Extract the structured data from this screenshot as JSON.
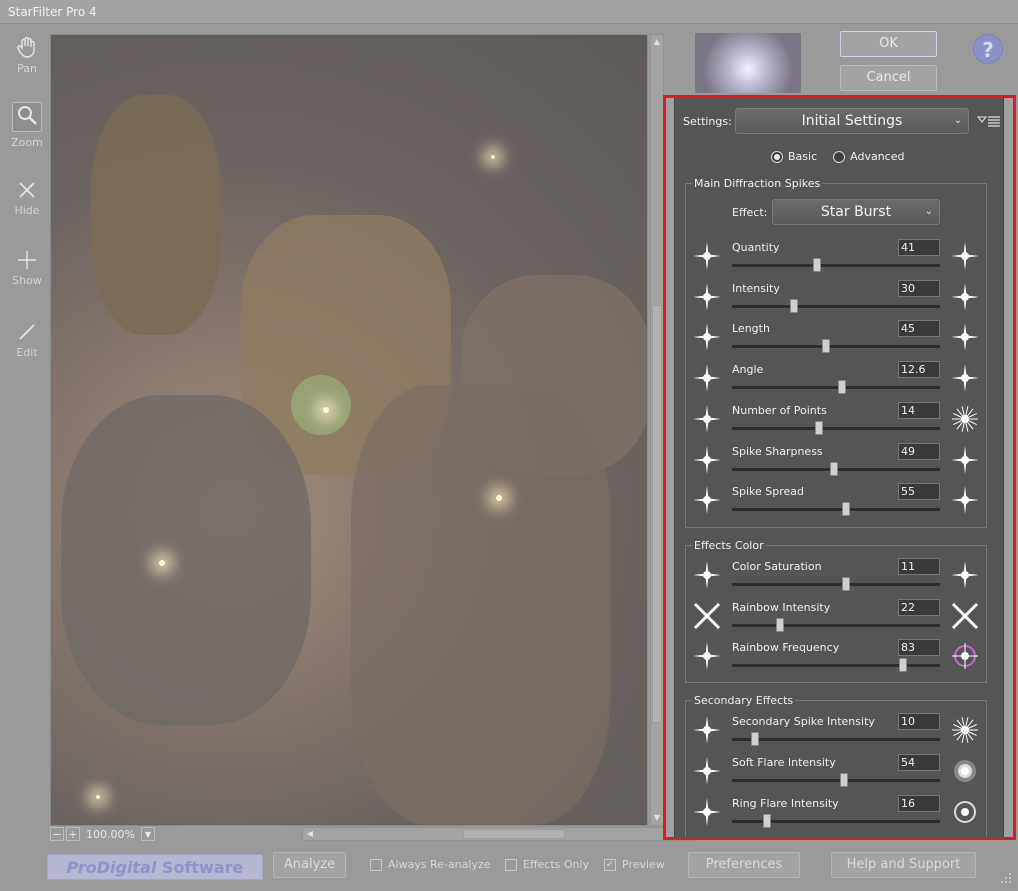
{
  "window": {
    "title": "StarFilter Pro 4"
  },
  "toolbar": {
    "pan": "Pan",
    "zoom": "Zoom",
    "hide": "Hide",
    "show": "Show",
    "edit": "Edit"
  },
  "zoom": {
    "level": "100.00%"
  },
  "buttons": {
    "ok": "OK",
    "cancel": "Cancel",
    "help": "?"
  },
  "settings": {
    "label": "Settings:",
    "selected": "Initial Settings"
  },
  "mode": {
    "basic": "Basic",
    "advanced": "Advanced",
    "selected": "Basic"
  },
  "main_spikes": {
    "title": "Main Diffraction Spikes",
    "effect_label": "Effect:",
    "effect_value": "Star Burst",
    "params": [
      {
        "label": "Quantity",
        "value": "41",
        "pos": 41
      },
      {
        "label": "Intensity",
        "value": "30",
        "pos": 30
      },
      {
        "label": "Length",
        "value": "45",
        "pos": 45
      },
      {
        "label": "Angle",
        "value": "12.6",
        "pos": 53
      },
      {
        "label": "Number of Points",
        "value": "14",
        "pos": 42
      },
      {
        "label": "Spike Sharpness",
        "value": "49",
        "pos": 49
      },
      {
        "label": "Spike Spread",
        "value": "55",
        "pos": 55
      }
    ]
  },
  "effects_color": {
    "title": "Effects Color",
    "params": [
      {
        "label": "Color Saturation",
        "value": "11",
        "pos": 55
      },
      {
        "label": "Rainbow Intensity",
        "value": "22",
        "pos": 23
      },
      {
        "label": "Rainbow Frequency",
        "value": "83",
        "pos": 82
      }
    ]
  },
  "secondary": {
    "title": "Secondary Effects",
    "params": [
      {
        "label": "Secondary Spike Intensity",
        "value": "10",
        "pos": 11
      },
      {
        "label": "Soft Flare Intensity",
        "value": "54",
        "pos": 54
      },
      {
        "label": "Ring Flare Intensity",
        "value": "16",
        "pos": 17
      }
    ]
  },
  "bottom": {
    "logo_a": "ProDigital",
    "logo_b": " Software",
    "analyze": "Analyze",
    "always_reanalyze": "Always Re-analyze",
    "effects_only": "Effects Only",
    "preview": "Preview",
    "preferences": "Preferences",
    "help_support": "Help and Support"
  },
  "colors": {
    "highlight": "#e01a22",
    "panel": "#555555",
    "chrome": "#9a9a9a"
  }
}
